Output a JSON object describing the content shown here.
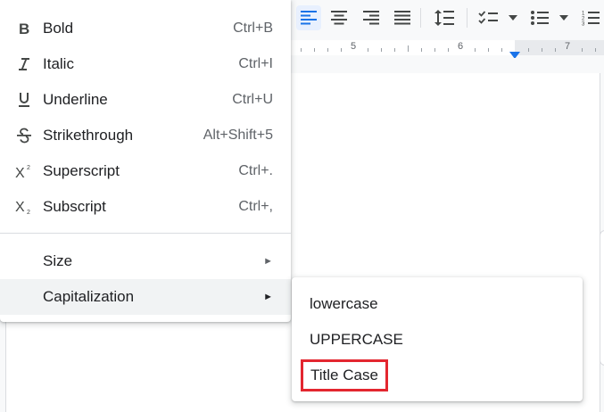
{
  "ruler": {
    "numbers": [
      "5",
      "6",
      "7"
    ]
  },
  "toolbar": {
    "icons": [
      "align-left-icon",
      "align-center-icon",
      "align-right-icon",
      "justify-icon",
      "line-spacing-icon",
      "checklist-icon",
      "bulleted-list-icon",
      "numbered-list-icon"
    ]
  },
  "format_menu": {
    "items": [
      {
        "icon": "bold-icon",
        "label": "Bold",
        "shortcut": "Ctrl+B"
      },
      {
        "icon": "italic-icon",
        "label": "Italic",
        "shortcut": "Ctrl+I"
      },
      {
        "icon": "underline-icon",
        "label": "Underline",
        "shortcut": "Ctrl+U"
      },
      {
        "icon": "strikethrough-icon",
        "label": "Strikethrough",
        "shortcut": "Alt+Shift+5"
      },
      {
        "icon": "superscript-icon",
        "label": "Superscript",
        "shortcut": "Ctrl+."
      },
      {
        "icon": "subscript-icon",
        "label": "Subscript",
        "shortcut": "Ctrl+,"
      }
    ],
    "size_label": "Size",
    "capitalization_label": "Capitalization",
    "arrow": "►"
  },
  "capitalization_submenu": {
    "items": [
      "lowercase",
      "UPPERCASE",
      "Title Case"
    ],
    "highlighted": "Title Case",
    "highlight_color": "#e3262f"
  },
  "colors": {
    "accent": "#1a73e8",
    "hover": "#f1f3f4"
  }
}
